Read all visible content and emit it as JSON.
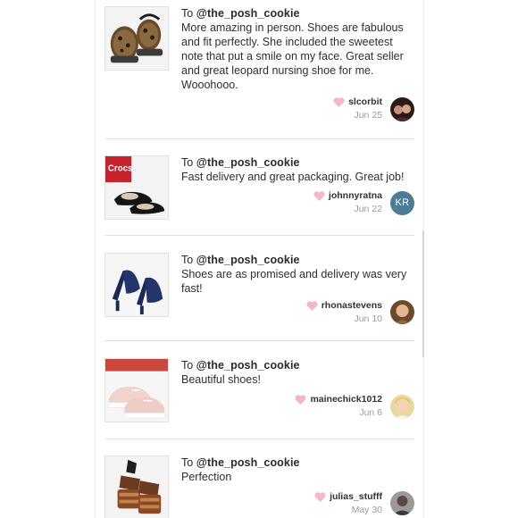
{
  "reviews": [
    {
      "to_prefix": "To ",
      "to_handle": "@the_posh_cookie",
      "text": "More amazing in person. Shoes are fabulous and fit perfectly. She included the sweetest note that put a smile on my face. Great seller and great leopard nursing shoe for me. Wooohooo.",
      "username": "slcorbit",
      "date": "Jun 25",
      "avatar_initials": "",
      "product_image": "leopard-clog-shoes-icon"
    },
    {
      "to_prefix": "To ",
      "to_handle": "@the_posh_cookie",
      "text": "Fast delivery and great packaging. Great job!",
      "username": "johnnyratna",
      "date": "Jun 22",
      "avatar_initials": "KR",
      "product_image": "crocs-black-flats-icon"
    },
    {
      "to_prefix": "To ",
      "to_handle": "@the_posh_cookie",
      "text": "Shoes are as promised and delivery was very fast!",
      "username": "rhonastevens",
      "date": "Jun 10",
      "avatar_initials": "",
      "product_image": "navy-peep-toe-heels-icon"
    },
    {
      "to_prefix": "To ",
      "to_handle": "@the_posh_cookie",
      "text": "Beautiful shoes!",
      "username": "mainechick1012",
      "date": "Jun 6",
      "avatar_initials": "",
      "product_image": "pink-sneakers-icon"
    },
    {
      "to_prefix": "To ",
      "to_handle": "@the_posh_cookie",
      "text": "Perfection",
      "username": "julias_stufff",
      "date": "May 30",
      "avatar_initials": "",
      "product_image": "strappy-platform-sandals-icon"
    }
  ],
  "colors": {
    "heart": "#f5b8c2",
    "divider": "#e2e2e2",
    "initials_avatar_bg": "#4d7c96"
  }
}
